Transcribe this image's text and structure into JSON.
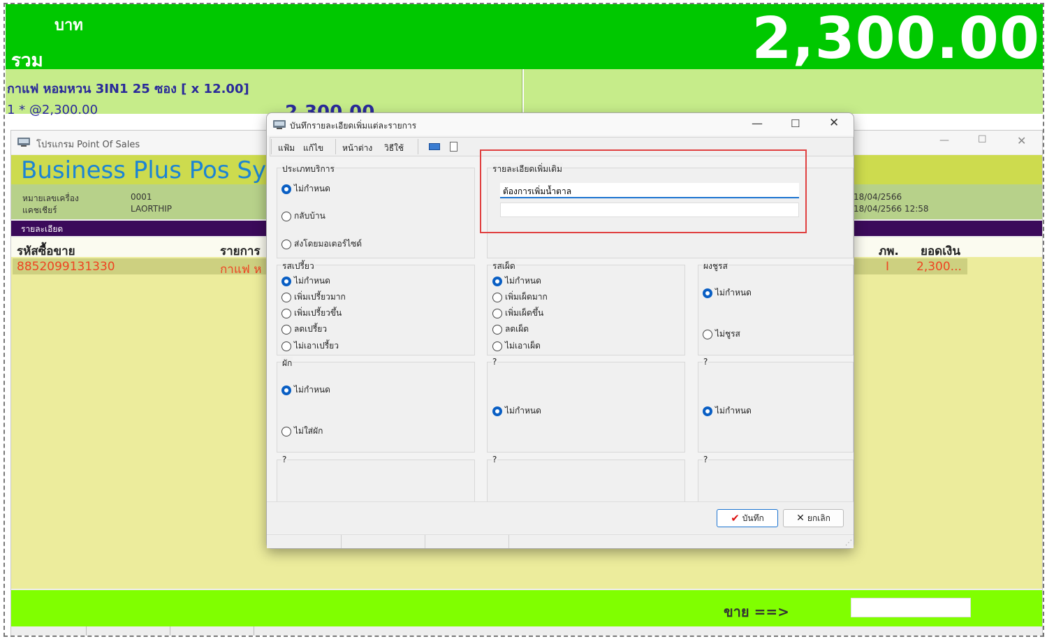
{
  "total_bar": {
    "currency": "บาท",
    "label": "รวม",
    "amount": "2,300.00"
  },
  "last_item": {
    "name": "กาแฟ หอมหวน 3IN1 25 ซอง [ x 12.00]",
    "qty_price": "1 * @2,300.00",
    "line_total": "2,300.00"
  },
  "pos_window": {
    "title": "โปรแกรม Point Of Sales",
    "banner": "Business Plus Pos Sy",
    "machine_label": "หมายเลขเครื่อง",
    "machine_value": "0001",
    "cashier_label": "แคชเชียร์",
    "cashier_value": "LAORTHIP",
    "date_value": "18/04/2566",
    "datetime_value": "18/04/2566 12:58",
    "detail_label": "รายละเอียด",
    "columns": {
      "code": "รหัสซื้อขาย",
      "name": "รายการ",
      "vat": "ภพ.",
      "amount": "ยอดเงิน"
    },
    "row": {
      "code": "8852099131330",
      "name": "กาแฟ ห",
      "vat": "I",
      "amount": "2,300..."
    },
    "sale_label": "ขาย ==>"
  },
  "dialog": {
    "title": "บันทึกรายละเอียดเพิ่มแต่ละรายการ",
    "menu": [
      "แฟ้ม",
      "แก้ไข",
      "หน้าต่าง",
      "วิธีใช้"
    ],
    "service_group": {
      "title": "ประเภทบริการ",
      "options": [
        "ไม่กำหนด",
        "กลับบ้าน",
        "ส่งโดยมอเตอร์ไซด์"
      ],
      "selected": 0
    },
    "extra_group": {
      "title": "รายละเอียดเพิ่มเติม",
      "line1": "ต้องการเพิ่มน้ำตาล",
      "line2": ""
    },
    "sour_group": {
      "title": "รสเปรี้ยว",
      "options": [
        "ไม่กำหนด",
        "เพิ่มเปรี้ยวมาก",
        "เพิ่มเปรี้ยวขึ้น",
        "ลดเปรี้ยว",
        "ไม่เอาเปรี้ยว"
      ],
      "selected": 0
    },
    "spicy_group": {
      "title": "รสเผ็ด",
      "options": [
        "ไม่กำหนด",
        "เพิ่มเผ็ดมาก",
        "เพิ่มเผ็ดขึ้น",
        "ลดเผ็ด",
        "ไม่เอาเผ็ด"
      ],
      "selected": 0
    },
    "msg_group": {
      "title": "ผงชูรส",
      "options": [
        "ไม่กำหนด",
        "ไม่ชูรส"
      ],
      "selected": 0
    },
    "veg_group": {
      "title": "ผัก",
      "options": [
        "ไม่กำหนด",
        "ไม่ใส่ผัก"
      ],
      "selected": 0
    },
    "unknown_groups": {
      "title": "?",
      "option": "ไม่กำหนด"
    },
    "save_label": "บันทึก",
    "cancel_label": "ยกเลิก"
  },
  "colors": {
    "total_bar": "#00c800",
    "item_panel": "#c6ec8a",
    "banner": "#cddb4e",
    "detail_bar": "#3b0a5a",
    "grid": "#ecec9c",
    "sale_bar": "#80ff00",
    "highlight": "#e04040",
    "accent": "#1a73d0"
  }
}
